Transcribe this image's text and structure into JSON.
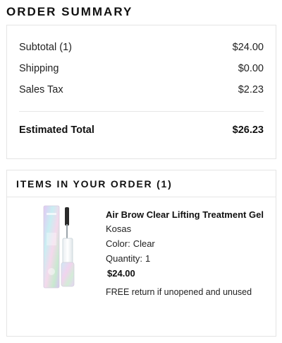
{
  "page_title": "ORDER SUMMARY",
  "summary": {
    "rows": [
      {
        "label": "Subtotal (1)",
        "value": "$24.00"
      },
      {
        "label": "Shipping",
        "value": "$0.00"
      },
      {
        "label": "Sales Tax",
        "value": "$2.23"
      }
    ],
    "total": {
      "label": "Estimated Total",
      "value": "$26.23"
    }
  },
  "items": {
    "header": "ITEMS IN YOUR ORDER (1)",
    "product": {
      "name": "Air Brow Clear Lifting Treatment Gel",
      "brand": "Kosas",
      "color_label": "Color:",
      "color_value": "Clear",
      "quantity_label": "Quantity:",
      "quantity_value": "1",
      "price": "$24.00",
      "return_note": "FREE return if unopened and unused",
      "image_icon": "brow-gel-tube-image",
      "image_colors": [
        "#d9c4ef",
        "#c7ecf0",
        "#f3d6ea",
        "#bfe3c9"
      ]
    }
  }
}
